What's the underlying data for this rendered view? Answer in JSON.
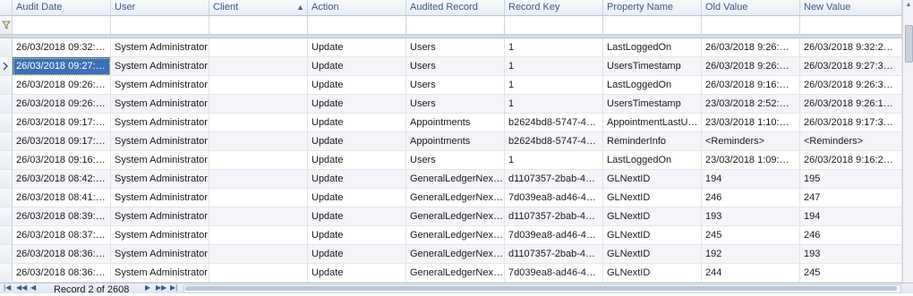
{
  "columns": [
    "Audit Date",
    "User",
    "Client",
    "Action",
    "Audited Record",
    "Record Key",
    "Property Name",
    "Old Value",
    "New Value"
  ],
  "sort_column": "Client",
  "filter_icon": "filter-icon",
  "selected_row_index": 1,
  "rows": [
    [
      "26/03/2018 09:32:…",
      "System Administrator",
      "",
      "Update",
      "Users",
      "1",
      "LastLoggedOn",
      "26/03/2018 9:26:…",
      "26/03/2018 9:32:2…"
    ],
    [
      "26/03/2018 09:27:…",
      "System Administrator",
      "",
      "Update",
      "Users",
      "1",
      "UsersTimestamp",
      "26/03/2018 9:26:…",
      "26/03/2018 9:27:3…"
    ],
    [
      "26/03/2018 09:26:…",
      "System Administrator",
      "",
      "Update",
      "Users",
      "1",
      "LastLoggedOn",
      "26/03/2018 9:16:…",
      "26/03/2018 9:26:3…"
    ],
    [
      "26/03/2018 09:26:…",
      "System Administrator",
      "",
      "Update",
      "Users",
      "1",
      "UsersTimestamp",
      "23/03/2018 2:52:…",
      "26/03/2018 9:26:1…"
    ],
    [
      "26/03/2018 09:17:…",
      "System Administrator",
      "",
      "Update",
      "Appointments",
      "b2624bd8-5747-4…",
      "AppointmentLastU…",
      "23/03/2018 1:10:…",
      "26/03/2018 9:17:3…"
    ],
    [
      "26/03/2018 09:17:…",
      "System Administrator",
      "",
      "Update",
      "Appointments",
      "b2624bd8-5747-4…",
      "ReminderInfo",
      "<Reminders>",
      "<Reminders>"
    ],
    [
      "26/03/2018 09:16:…",
      "System Administrator",
      "",
      "Update",
      "Users",
      "1",
      "LastLoggedOn",
      "23/03/2018 1:09:…",
      "26/03/2018 9:16:2…"
    ],
    [
      "26/03/2018 08:42:…",
      "System Administrator",
      "",
      "Update",
      "GeneralLedgerNex…",
      "d1107357-2bab-4…",
      "GLNextID",
      "194",
      "195"
    ],
    [
      "26/03/2018 08:41:…",
      "System Administrator",
      "",
      "Update",
      "GeneralLedgerNex…",
      "7d039ea8-ad46-4…",
      "GLNextID",
      "246",
      "247"
    ],
    [
      "26/03/2018 08:39:…",
      "System Administrator",
      "",
      "Update",
      "GeneralLedgerNex…",
      "d1107357-2bab-4…",
      "GLNextID",
      "193",
      "194"
    ],
    [
      "26/03/2018 08:37:…",
      "System Administrator",
      "",
      "Update",
      "GeneralLedgerNex…",
      "7d039ea8-ad46-4…",
      "GLNextID",
      "245",
      "246"
    ],
    [
      "26/03/2018 08:36:…",
      "System Administrator",
      "",
      "Update",
      "GeneralLedgerNex…",
      "d1107357-2bab-4…",
      "GLNextID",
      "192",
      "193"
    ],
    [
      "26/03/2018 08:36:…",
      "System Administrator",
      "",
      "Update",
      "GeneralLedgerNex…",
      "7d039ea8-ad46-4…",
      "GLNextID",
      "244",
      "245"
    ]
  ],
  "navigator": {
    "record_text": "Record 2 of 2608"
  }
}
